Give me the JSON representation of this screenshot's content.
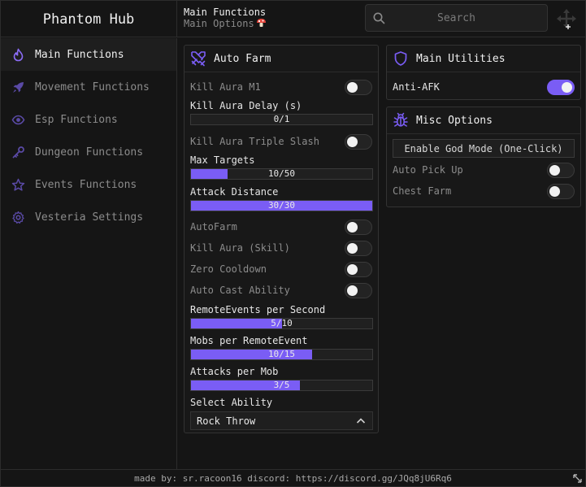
{
  "header": {
    "title": "Phantom Hub",
    "crumb_title": "Main Functions",
    "crumb_sub": "Main Options"
  },
  "search": {
    "placeholder": "Search"
  },
  "sidebar": {
    "items": [
      {
        "label": "Main Functions",
        "icon": "flame-icon",
        "active": true
      },
      {
        "label": "Movement Functions",
        "icon": "rocket-icon"
      },
      {
        "label": "Esp Functions",
        "icon": "eye-icon"
      },
      {
        "label": "Dungeon Functions",
        "icon": "key-icon"
      },
      {
        "label": "Events Functions",
        "icon": "star-icon"
      },
      {
        "label": "Vesteria Settings",
        "icon": "gear-icon"
      }
    ]
  },
  "auto_farm": {
    "title": "Auto Farm",
    "kill_aura_m1": "Kill Aura M1",
    "kill_aura_delay": {
      "label": "Kill Aura Delay (s)",
      "text": "0/1",
      "fraction": 0
    },
    "triple_slash": "Kill Aura Triple Slash",
    "max_targets": {
      "label": "Max Targets",
      "text": "10/50",
      "fraction": 0.2
    },
    "attack_distance": {
      "label": "Attack Distance",
      "text": "30/30",
      "fraction": 1
    },
    "autofarm": "AutoFarm",
    "kill_aura_skill": "Kill Aura (Skill)",
    "zero_cooldown": "Zero Cooldown",
    "auto_cast": "Auto Cast Ability",
    "remote_events": {
      "label": "RemoteEvents per Second",
      "text": "5/10",
      "fraction": 0.5
    },
    "mobs_per_remote": {
      "label": "Mobs per RemoteEvent",
      "text": "10/15",
      "fraction": 0.667
    },
    "attacks_per_mob": {
      "label": "Attacks per Mob",
      "text": "3/5",
      "fraction": 0.6
    },
    "select_ability": {
      "label": "Select Ability",
      "value": "Rock Throw"
    }
  },
  "main_utilities": {
    "title": "Main Utilities",
    "anti_afk": "Anti-AFK",
    "anti_afk_on": true
  },
  "misc_options": {
    "title": "Misc Options",
    "god_mode_button": "Enable God Mode (One-Click)",
    "auto_pick_up": "Auto Pick Up",
    "chest_farm": "Chest Farm"
  },
  "footer": {
    "text": "made by: sr.racoon16 discord: https://discord.gg/JQq8jU6Rq6"
  },
  "colors": {
    "accent": "#7a5df5",
    "background": "#151515",
    "panel": "#181818"
  }
}
